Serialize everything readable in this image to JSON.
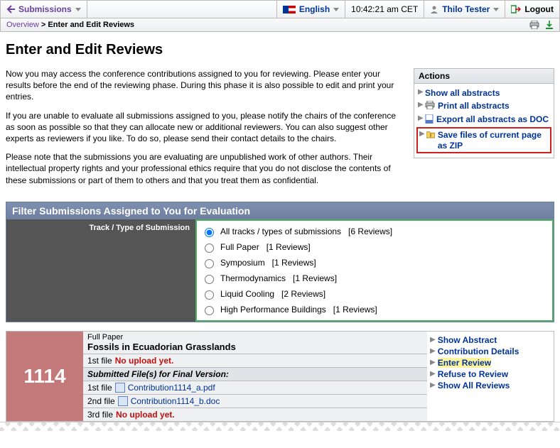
{
  "topbar": {
    "submissions": "Submissions",
    "language": "English",
    "clock": "10:42:21 am CET",
    "user": "Thilo Tester",
    "logout": "Logout"
  },
  "breadcrumb": {
    "overview": "Overview",
    "sep": " > ",
    "current": "Enter and Edit Reviews"
  },
  "page_title": "Enter and Edit Reviews",
  "intro": {
    "p1": "Now you may access the conference contributions assigned to you for reviewing. Please enter your results before the end of the reviewing phase. During this phase it is also possible to edit and print your entries.",
    "p2": "If you are unable to evaluate all submissions assigned to you, please notify the chairs of the conference as soon as possible so that they can allocate new or additional reviewers. You can also suggest other experts as reviewers if you like. To do so, please send their contact details to the chairs.",
    "p3": "Please note that the submissions you are evaluating are unpublished work of other authors. Their intellectual property rights and your professional ethics require that you do not disclose the contents of these submissions or part of them to others and that you treat them as confidential."
  },
  "actions": {
    "title": "Actions",
    "show_all": "Show all abstracts",
    "print_all": "Print all abstracts",
    "export_doc": "Export all abstracts as DOC",
    "save_zip": "Save files of current page as ZIP"
  },
  "filter": {
    "heading": "Filter Submissions Assigned to You for Evaluation",
    "label": "Track / Type of Submission",
    "options": [
      {
        "label": "All tracks / types of submissions",
        "count": "[6 Reviews]",
        "selected": true
      },
      {
        "label": "Full Paper",
        "count": "[1 Reviews]",
        "selected": false
      },
      {
        "label": "Symposium",
        "count": "[1 Reviews]",
        "selected": false
      },
      {
        "label": "Thermodynamics",
        "count": "[1 Reviews]",
        "selected": false
      },
      {
        "label": "Liquid Cooling",
        "count": "[2 Reviews]",
        "selected": false
      },
      {
        "label": "High Performance Buildings",
        "count": "[1 Reviews]",
        "selected": false
      }
    ]
  },
  "submission": {
    "id": "1114",
    "track": "Full Paper",
    "title": "Fossils in Ecuadorian Grasslands",
    "row1_label": "1st file",
    "row1_status": "No upload yet.",
    "submitted_header": "Submitted File(s) for Final Version:",
    "file1_label": "1st file",
    "file1_name": "Contribution1114_a.pdf",
    "file2_label": "2nd file",
    "file2_name": "Contribution1114_b.doc",
    "file3_label": "3rd file",
    "file3_status": "No upload yet.",
    "actions": {
      "show_abstract": "Show Abstract",
      "contrib_details": "Contribution Details",
      "enter_review": "Enter Review",
      "refuse": "Refuse to Review",
      "show_all_reviews": "Show All Reviews"
    }
  }
}
